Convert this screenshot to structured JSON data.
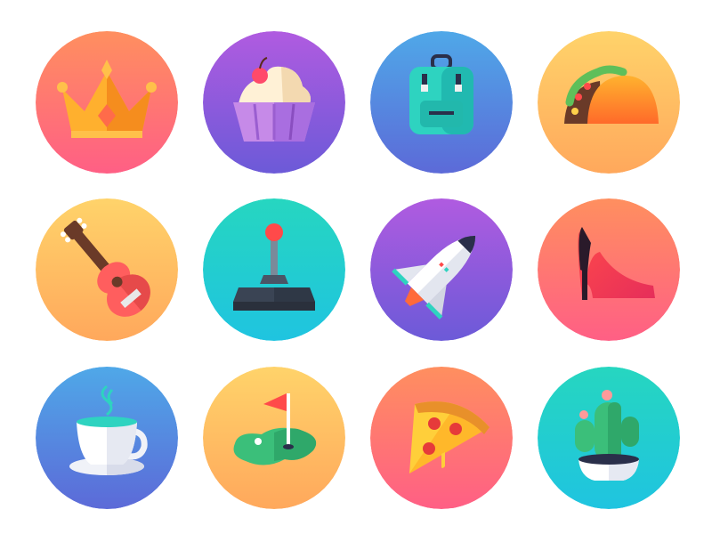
{
  "icons": [
    {
      "name": "crown-icon",
      "bg": [
        "#ff8f5f",
        "#ff5f85"
      ]
    },
    {
      "name": "cupcake-icon",
      "bg": [
        "#b05be0",
        "#6c5ad8"
      ]
    },
    {
      "name": "backpack-icon",
      "bg": [
        "#4fa8e8",
        "#5c6ad8"
      ]
    },
    {
      "name": "taco-icon",
      "bg": [
        "#ffd36a",
        "#ffa85c"
      ]
    },
    {
      "name": "guitar-icon",
      "bg": [
        "#ffd36a",
        "#ffa85c"
      ]
    },
    {
      "name": "joystick-icon",
      "bg": [
        "#26d6c0",
        "#1fc4e0"
      ]
    },
    {
      "name": "space-shuttle-icon",
      "bg": [
        "#b05be0",
        "#6c5ad8"
      ]
    },
    {
      "name": "high-heel-icon",
      "bg": [
        "#ff8f5f",
        "#ff5f85"
      ]
    },
    {
      "name": "tea-cup-icon",
      "bg": [
        "#4fa8e8",
        "#5c6ad8"
      ]
    },
    {
      "name": "golf-flag-icon",
      "bg": [
        "#ffd36a",
        "#ffa85c"
      ]
    },
    {
      "name": "pizza-slice-icon",
      "bg": [
        "#ff8f5f",
        "#ff5f85"
      ]
    },
    {
      "name": "cactus-icon",
      "bg": [
        "#26d6c0",
        "#1fc4e0"
      ]
    }
  ]
}
